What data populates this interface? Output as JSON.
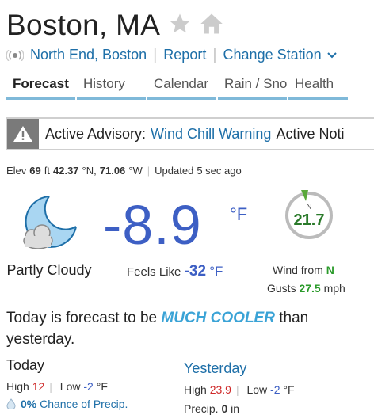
{
  "header": {
    "city": "Boston, MA",
    "icons": [
      "star-icon",
      "home-icon"
    ]
  },
  "station": {
    "name": "North End, Boston",
    "report": "Report",
    "change": "Change Station"
  },
  "tabs": [
    {
      "label": "Forecast",
      "active": true
    },
    {
      "label": "History",
      "active": false
    },
    {
      "label": "Calendar",
      "active": false
    },
    {
      "label": "Rain / Snow",
      "active": false
    },
    {
      "label": "Health",
      "active": false
    }
  ],
  "advisory": {
    "label": "Active Advisory:",
    "warning": "Wind Chill Warning",
    "tail": "Active Noti"
  },
  "meta": {
    "elev_label": "Elev",
    "elev": "69",
    "elev_unit": "ft",
    "lat": "42.37",
    "lat_dir": "°N,",
    "lon": "71.06",
    "lon_dir": "°W",
    "updated_label": "Updated",
    "updated": "5 sec ago"
  },
  "current": {
    "condition": "Partly Cloudy",
    "temp": "-8.9",
    "unit": "°F",
    "feels_label": "Feels Like",
    "feels": "-32",
    "feels_unit": "°F"
  },
  "wind": {
    "speed": "21.7",
    "compass_letter": "N",
    "from_label": "Wind from",
    "dir": "N",
    "gusts_label": "Gusts",
    "gusts": "27.5",
    "gusts_unit": "mph"
  },
  "summary": {
    "pre": "Today is forecast to be ",
    "highlight": "MUCH COOLER",
    "post": " than yesterday."
  },
  "today": {
    "title": "Today",
    "high_label": "High",
    "high": "12",
    "low_label": "Low",
    "low": "-2",
    "unit": "°F",
    "precip": "0%",
    "precip_label": "Chance of Precip."
  },
  "yesterday": {
    "title": "Yesterday",
    "high_label": "High",
    "high": "23.9",
    "low_label": "Low",
    "low": "-2",
    "unit": "°F",
    "precip_label": "Precip.",
    "precip": "0",
    "precip_unit": "in"
  },
  "colors": {
    "accent": "#1e6fa8",
    "temp": "#3d5fc4",
    "tab_underline": "#7fb9d9",
    "wind": "#2a9a2a",
    "high": "#cf2a2a"
  }
}
